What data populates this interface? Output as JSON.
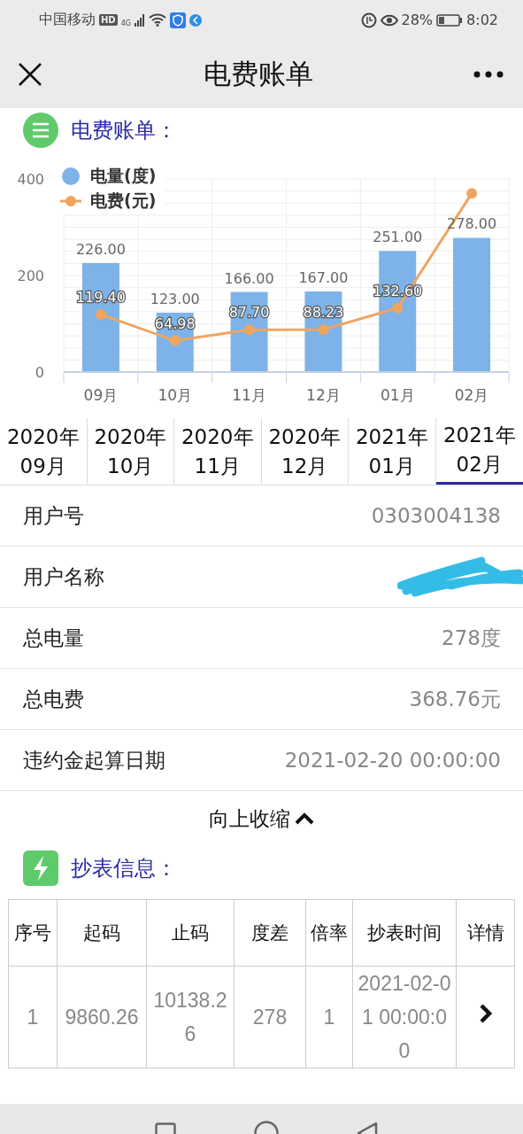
{
  "status_bar": {
    "carrier": "中国移动",
    "hd": "HD",
    "network": "4G",
    "battery": "28%",
    "time": "8:02"
  },
  "nav_bar": {
    "title": "电费账单"
  },
  "bill_section": {
    "title": "电费账单：",
    "chart_data": {
      "type": "bar",
      "categories": [
        "09月",
        "10月",
        "11月",
        "12月",
        "01月",
        "02月"
      ],
      "ylim": [
        0,
        400
      ],
      "legend": true,
      "yticks": [
        0,
        200,
        400
      ],
      "series": [
        {
          "name": "电量(度)",
          "color": "#7db3e8",
          "values": [
            226,
            123,
            166,
            167,
            251,
            278
          ],
          "value_labels": [
            "226.00",
            "123.00",
            "166.00",
            "167.00",
            "251.00",
            "278.00"
          ]
        },
        {
          "name": "电费(元)",
          "type": "line",
          "marker": "circle",
          "color": "#f0a55f",
          "values": [
            119.4,
            64.98,
            87.7,
            88.23,
            132.6,
            370
          ],
          "value_labels": [
            "119.40",
            "64.98",
            "87.70",
            "88.23",
            "132.60",
            null
          ]
        }
      ]
    }
  },
  "month_tabs": [
    {
      "year": "2020年",
      "month": "09月",
      "selected": false
    },
    {
      "year": "2020年",
      "month": "10月",
      "selected": false
    },
    {
      "year": "2020年",
      "month": "11月",
      "selected": false
    },
    {
      "year": "2020年",
      "month": "12月",
      "selected": false
    },
    {
      "year": "2021年",
      "month": "01月",
      "selected": false
    },
    {
      "year": "2021年",
      "month": "02月",
      "selected": true
    }
  ],
  "details": [
    {
      "label": "用户号",
      "value": "0303004138"
    },
    {
      "label": "用户名称",
      "redacted": true
    },
    {
      "label": "总电量",
      "value": "278度"
    },
    {
      "label": "总电费",
      "value": "368.76元"
    },
    {
      "label": "违约金起算日期",
      "value": "2021-02-20 00:00:00"
    }
  ],
  "collapse_link": "向上收缩",
  "reading_section": {
    "title": "抄表信息：",
    "table": {
      "columns": [
        "序号",
        "起码",
        "止码",
        "度差",
        "倍率",
        "抄表时间",
        "详情"
      ],
      "rows": [
        [
          "1",
          "9860.26",
          "10138.26",
          "278",
          "1",
          "2021-02-01 00:00:00"
        ]
      ]
    }
  }
}
